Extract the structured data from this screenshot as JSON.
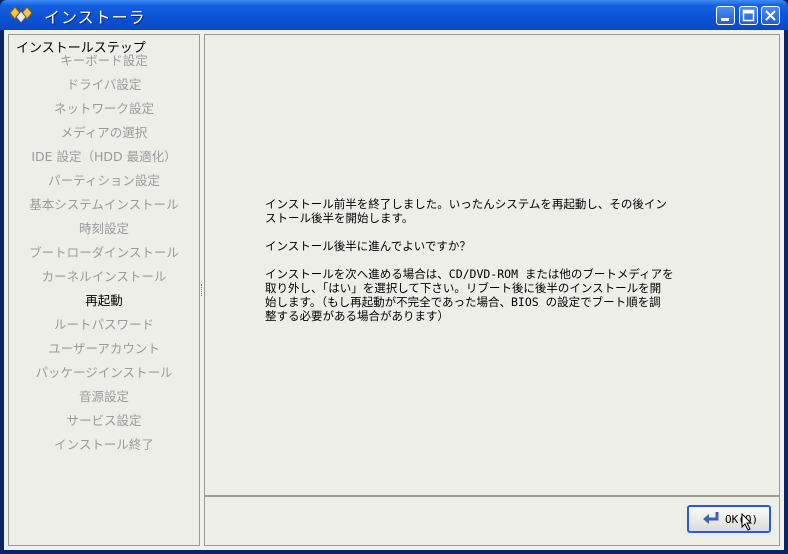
{
  "window": {
    "title": "インストーラ",
    "icon": "installer-diamond-icon",
    "controls": [
      "minimize-icon",
      "maximize-icon",
      "close-icon"
    ]
  },
  "sidebar": {
    "group_title": "インストールステップ",
    "items": [
      {
        "label": "キーボード設定",
        "active": false
      },
      {
        "label": "ドライバ設定",
        "active": false
      },
      {
        "label": "ネットワーク設定",
        "active": false
      },
      {
        "label": "メディアの選択",
        "active": false
      },
      {
        "label": "IDE 設定（HDD 最適化）",
        "active": false
      },
      {
        "label": "パーティション設定",
        "active": false
      },
      {
        "label": "基本システムインストール",
        "active": false
      },
      {
        "label": "時刻設定",
        "active": false
      },
      {
        "label": "ブートローダインストール",
        "active": false
      },
      {
        "label": "カーネルインストール",
        "active": false
      },
      {
        "label": "再起動",
        "active": true
      },
      {
        "label": "ルートパスワード",
        "active": false
      },
      {
        "label": "ユーザーアカウント",
        "active": false
      },
      {
        "label": "パッケージインストール",
        "active": false
      },
      {
        "label": "音源設定",
        "active": false
      },
      {
        "label": "サービス設定",
        "active": false
      },
      {
        "label": "インストール終了",
        "active": false
      }
    ]
  },
  "main": {
    "paragraphs": [
      "インストール前半を終了しました。いったんシステムを再起動し、その後イン\nストール後半を開始します。",
      "インストール後半に進んでよいですか？",
      "インストールを次へ進める場合は、CD/DVD-ROM または他のブートメディアを\n取り外し、「はい」を選択して下さい。リブート後に後半のインストールを開\n始します。（もし再起動が不完全であった場合、BIOS の設定でブート順を調\n整する必要がある場合があります）"
    ]
  },
  "footer": {
    "ok_label": "OK(O)",
    "ok_icon": "return-arrow-icon"
  },
  "colors": {
    "titlebar": "#0a52d6",
    "active_step": "#000000",
    "inactive_step": "#9a9a9a",
    "button_focus": "#2a5bd0"
  }
}
